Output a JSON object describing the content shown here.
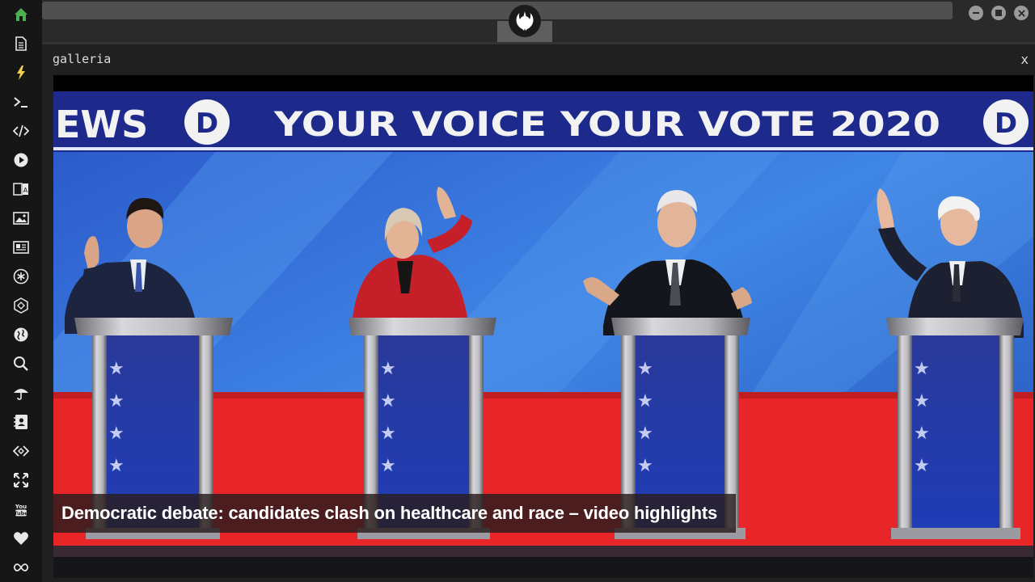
{
  "sidebar": {
    "items": [
      {
        "name": "home-icon",
        "color": "#4caf50"
      },
      {
        "name": "document-icon"
      },
      {
        "name": "lightning-icon",
        "color": "#f2d14a"
      },
      {
        "name": "terminal-icon"
      },
      {
        "name": "code-icon"
      },
      {
        "name": "play-icon"
      },
      {
        "name": "translate-icon"
      },
      {
        "name": "image-icon"
      },
      {
        "name": "news-icon"
      },
      {
        "name": "asterisk-icon"
      },
      {
        "name": "hexagon-icon"
      },
      {
        "name": "globe-icon"
      },
      {
        "name": "search-icon"
      },
      {
        "name": "umbrella-icon"
      },
      {
        "name": "contact-icon"
      },
      {
        "name": "code-brackets-icon"
      },
      {
        "name": "expand-icon"
      },
      {
        "name": "youtube-icon"
      },
      {
        "name": "heart-icon"
      },
      {
        "name": "infinity-icon"
      }
    ]
  },
  "window": {
    "title": "galleria",
    "close_label": "x"
  },
  "image": {
    "banner_text": "YOUR VOICE YOUR VOTE 2020",
    "banner_left_text": "EWS",
    "party_badge": "D",
    "caption": "Democratic debate: candidates clash on healthcare and race – video highlights"
  },
  "colors": {
    "accent_home": "#4caf50",
    "accent_bolt": "#f2d14a",
    "banner_blue": "#1d2a8c",
    "stage_red": "#e8262a"
  }
}
